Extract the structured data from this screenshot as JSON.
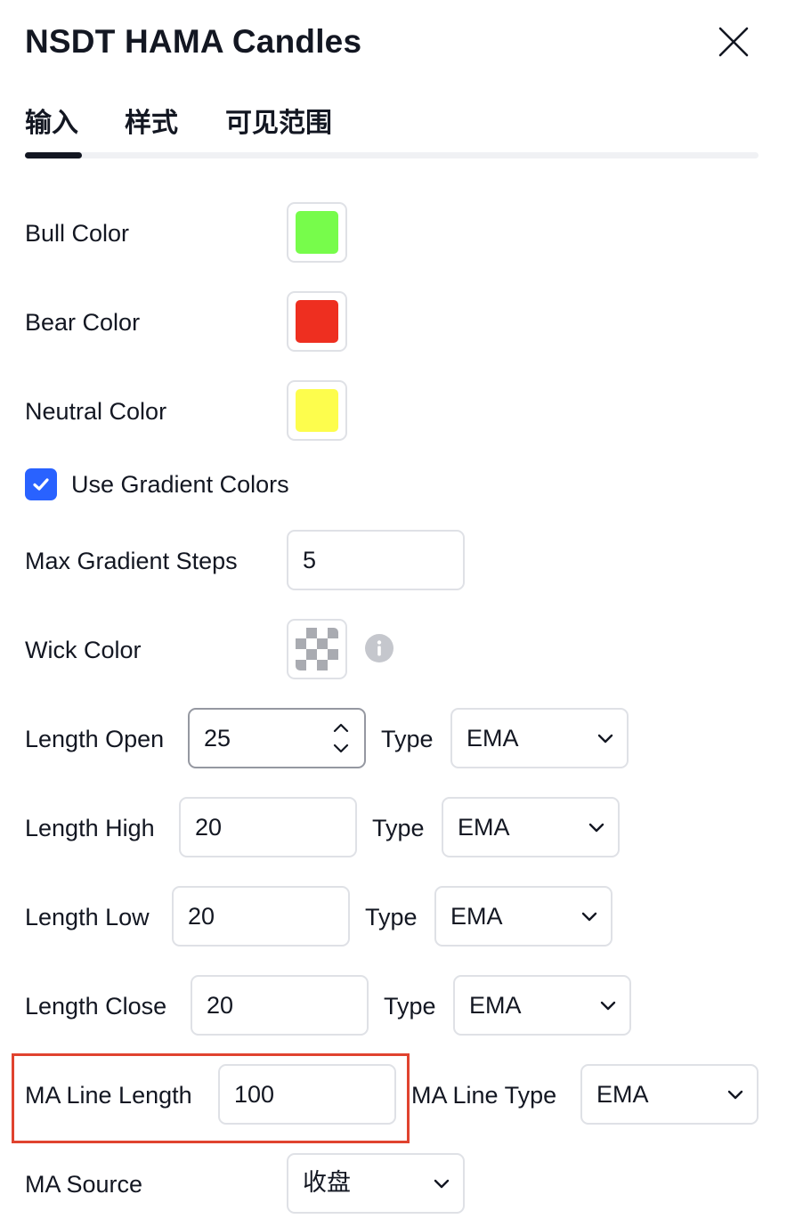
{
  "dialog": {
    "title": "NSDT HAMA Candles"
  },
  "tabs": [
    {
      "label": "输入",
      "active": true
    },
    {
      "label": "样式",
      "active": false
    },
    {
      "label": "可见范围",
      "active": false
    }
  ],
  "colors": {
    "bull": "#77fc4b",
    "bear": "#ee2f20",
    "neutral": "#fdfd4d",
    "accent": "#2962ff",
    "highlight_box": "#e0432f"
  },
  "inputs": {
    "bull_color_label": "Bull Color",
    "bear_color_label": "Bear Color",
    "neutral_color_label": "Neutral Color",
    "gradient_checkbox": {
      "label": "Use Gradient Colors",
      "checked": true
    },
    "max_gradient_steps": {
      "label": "Max Gradient Steps",
      "value": "5"
    },
    "wick_color_label": "Wick Color",
    "length_open": {
      "label": "Length Open",
      "value": "25",
      "type_label": "Type",
      "type_value": "EMA"
    },
    "length_high": {
      "label": "Length High",
      "value": "20",
      "type_label": "Type",
      "type_value": "EMA"
    },
    "length_low": {
      "label": "Length Low",
      "value": "20",
      "type_label": "Type",
      "type_value": "EMA"
    },
    "length_close": {
      "label": "Length Close",
      "value": "20",
      "type_label": "Type",
      "type_value": "EMA"
    },
    "ma_line_length": {
      "label": "MA Line Length",
      "value": "100"
    },
    "ma_line_type": {
      "label": "MA Line Type",
      "value": "EMA"
    },
    "ma_source": {
      "label": "MA Source",
      "value": "收盘"
    }
  },
  "icons": {
    "close": "close-icon",
    "checkbox": "checkmark-icon",
    "info": "info-icon",
    "stepper": "stepper-arrows-icon",
    "dropdown": "chevron-down-icon"
  }
}
